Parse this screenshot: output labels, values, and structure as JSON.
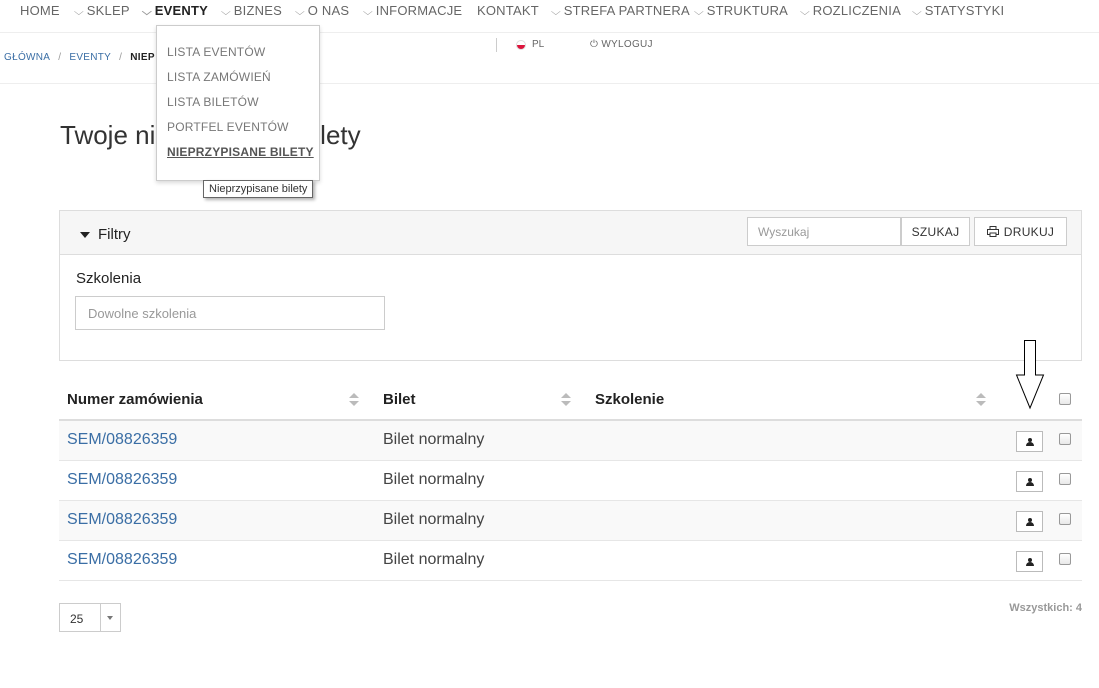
{
  "nav": {
    "items": [
      {
        "label": "HOME",
        "chevron": false,
        "active": false
      },
      {
        "label": "SKLEP",
        "chevron": true,
        "active": false
      },
      {
        "label": "EVENTY",
        "chevron": true,
        "active": true
      },
      {
        "label": "BIZNES",
        "chevron": true,
        "active": false
      },
      {
        "label": "O NAS",
        "chevron": true,
        "active": false
      },
      {
        "label": "INFORMACJE",
        "chevron": true,
        "active": false
      },
      {
        "label": "KONTAKT",
        "chevron": false,
        "active": false
      },
      {
        "label": "STREFA PARTNERA",
        "chevron": true,
        "active": false
      },
      {
        "label": "STRUKTURA",
        "chevron": true,
        "active": false
      },
      {
        "label": "ROZLICZENIA",
        "chevron": true,
        "active": false
      },
      {
        "label": "STATYSTYKI",
        "chevron": true,
        "active": false
      }
    ]
  },
  "breadcrumb": {
    "home": "GŁÓWNA",
    "section": "EVENTY",
    "current": "NIEP"
  },
  "topbar": {
    "language": "PL",
    "logout": "WYLOGUJ"
  },
  "dropdown": {
    "items": [
      {
        "label": "LISTA EVENTÓW"
      },
      {
        "label": "LISTA ZAMÓWIEŃ"
      },
      {
        "label": "LISTA BILETÓW"
      },
      {
        "label": "PORTFEL EVENTÓW"
      },
      {
        "label": "NIEPRZYPISANE BILETY"
      }
    ],
    "tooltip": "Nieprzypisane bilety"
  },
  "page": {
    "title_left": "Twoje ni",
    "title_right": "ilety"
  },
  "filters": {
    "toggle_label": "Filtry",
    "search_placeholder": "Wyszukaj",
    "search_button": "SZUKAJ",
    "print_button": "DRUKUJ",
    "training_label": "Szkolenia",
    "training_placeholder": "Dowolne szkolenia"
  },
  "table": {
    "columns": [
      "Numer zamówienia",
      "Bilet",
      "Szkolenie"
    ],
    "rows": [
      {
        "order": "SEM/08826359",
        "ticket": "Bilet normalny",
        "training": ""
      },
      {
        "order": "SEM/08826359",
        "ticket": "Bilet normalny",
        "training": ""
      },
      {
        "order": "SEM/08826359",
        "ticket": "Bilet normalny",
        "training": ""
      },
      {
        "order": "SEM/08826359",
        "ticket": "Bilet normalny",
        "training": ""
      }
    ]
  },
  "footer": {
    "page_size": "25",
    "total": "Wszystkich: 4"
  },
  "colors": {
    "link": "#3a6ea5",
    "text": "#333333",
    "border": "#dddddd"
  }
}
